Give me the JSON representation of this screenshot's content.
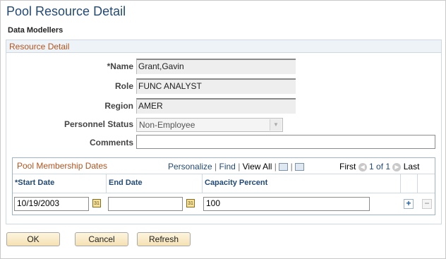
{
  "page": {
    "title": "Pool Resource Detail",
    "subtitle": "Data Modellers"
  },
  "resource_detail": {
    "section_title": "Resource Detail",
    "name_label": "*Name",
    "name_value": "Grant,Gavin",
    "role_label": "Role",
    "role_value": "FUNC ANALYST",
    "region_label": "Region",
    "region_value": "AMER",
    "personnel_status_label": "Personnel Status",
    "personnel_status_value": "Non-Employee",
    "comments_label": "Comments",
    "comments_value": ""
  },
  "membership": {
    "title": "Pool Membership Dates",
    "personalize": "Personalize",
    "find": "Find",
    "view_all": "View All",
    "first": "First",
    "range": "1 of 1",
    "last": "Last",
    "columns": {
      "start_date": "*Start Date",
      "end_date": "End Date",
      "capacity": "Capacity Percent"
    },
    "rows": [
      {
        "start_date": "10/19/2003",
        "end_date": "",
        "capacity": "100"
      }
    ]
  },
  "buttons": {
    "ok": "OK",
    "cancel": "Cancel",
    "refresh": "Refresh"
  },
  "icons": {
    "calendar": "calendar-icon",
    "add_row": "plus-icon",
    "delete_row": "minus-icon",
    "prev": "left-arrow-icon",
    "next": "right-arrow-icon",
    "zoom": "new-window-icon",
    "download": "spreadsheet-icon",
    "select_arrow": "chevron-down-icon"
  },
  "colors": {
    "title": "#234a74",
    "section_title": "#b3541e",
    "link": "#234a74"
  }
}
